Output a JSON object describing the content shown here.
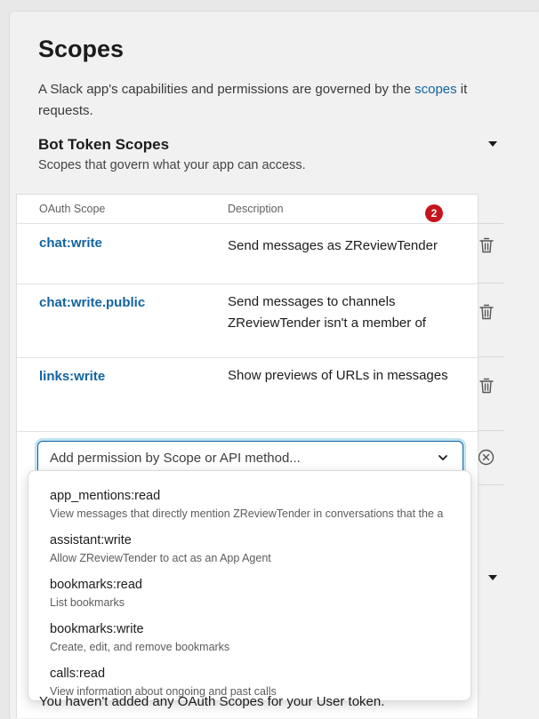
{
  "page": {
    "title": "Scopes",
    "intro_before": "A Slack app's capabilities and permissions are governed by the ",
    "intro_link": "scopes",
    "intro_after": " it requests."
  },
  "bot_section": {
    "title": "Bot Token Scopes",
    "subtitle": "Scopes that govern what your app can access."
  },
  "table": {
    "col_scope": "OAuth Scope",
    "col_description": "Description",
    "badge": "2",
    "rows": [
      {
        "scope": "chat:write",
        "description": "Send messages as ZReviewTender"
      },
      {
        "scope": "chat:write.public",
        "description": "Send messages to channels ZReviewTender isn't a member of"
      },
      {
        "scope": "links:write",
        "description": "Show previews of URLs in messages"
      }
    ]
  },
  "add_permission": {
    "placeholder": "Add permission by Scope or API method..."
  },
  "dropdown": {
    "options": [
      {
        "name": "app_mentions:read",
        "description": "View messages that directly mention ZReviewTender in conversations that the a"
      },
      {
        "name": "assistant:write",
        "description": "Allow ZReviewTender to act as an App Agent"
      },
      {
        "name": "bookmarks:read",
        "description": "List bookmarks"
      },
      {
        "name": "bookmarks:write",
        "description": "Create, edit, and remove bookmarks"
      },
      {
        "name": "calls:read",
        "description": "View information about ongoing and past calls"
      }
    ]
  },
  "user_section": {
    "empty_text": "You haven't added any OAuth Scopes for your User token."
  },
  "icons": [
    "trash-icon",
    "clear-icon",
    "chevron-down-icon",
    "caret-down-icon"
  ],
  "colors": {
    "link": "#1264a3",
    "badge": "#c5161d",
    "focus_ring": "#1d9bd1"
  }
}
